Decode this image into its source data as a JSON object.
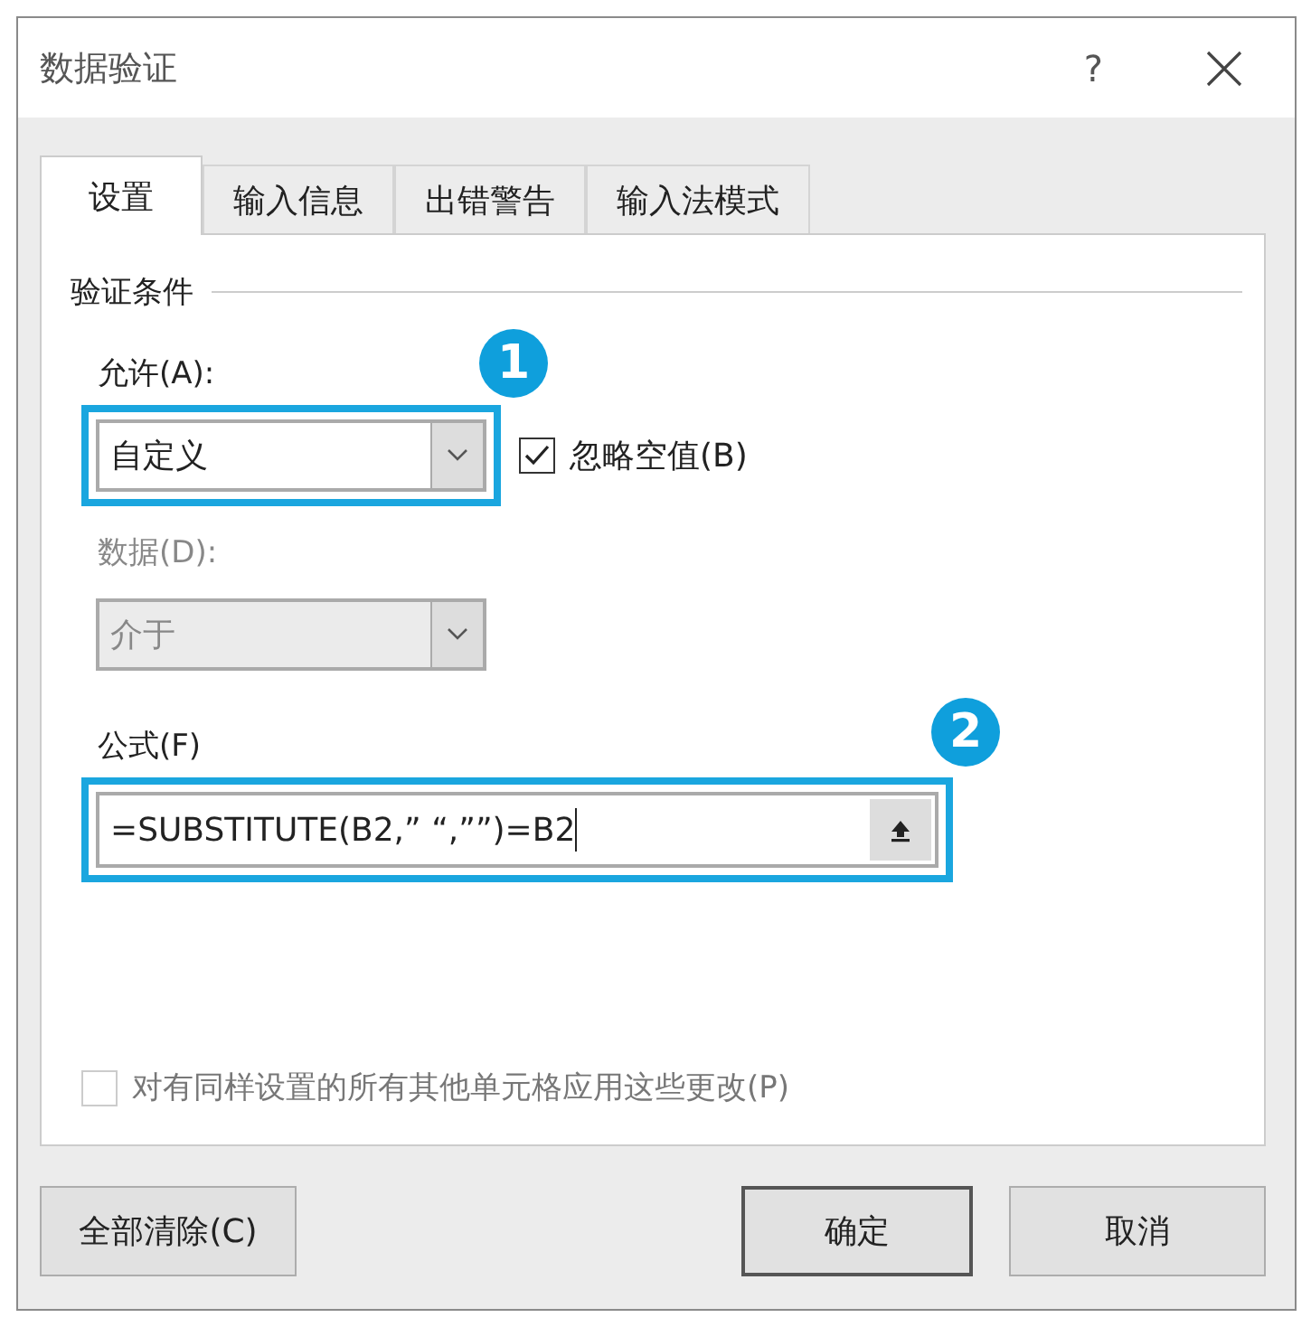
{
  "window": {
    "title": "数据验证",
    "help": "?"
  },
  "tabs": [
    {
      "label": "设置",
      "selected": true
    },
    {
      "label": "输入信息",
      "selected": false
    },
    {
      "label": "出错警告",
      "selected": false
    },
    {
      "label": "输入法模式",
      "selected": false
    }
  ],
  "section": "验证条件",
  "allow": {
    "label": "允许(A):",
    "value": "自定义",
    "highlighted": true,
    "badge": "1"
  },
  "ignore_blank": {
    "label": "忽略空值(B)",
    "checked": true
  },
  "data": {
    "label": "数据(D):",
    "value": "介于",
    "disabled": true
  },
  "formula": {
    "label": "公式(F)",
    "value": "=SUBSTITUTE(B2,” “,””)=B2",
    "highlighted": true,
    "badge": "2"
  },
  "apply_all": {
    "label": "对有同样设置的所有其他单元格应用这些更改(P)",
    "checked": false,
    "disabled": true
  },
  "buttons": [
    {
      "label": "全部清除(C)",
      "kind": "left",
      "default": false
    },
    {
      "label": "确定",
      "kind": "right",
      "default": true
    },
    {
      "label": "取消",
      "kind": "right",
      "default": false
    }
  ]
}
